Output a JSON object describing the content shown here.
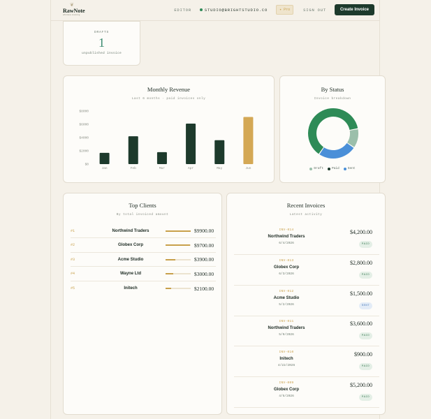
{
  "header": {
    "logo_name": "RawNote",
    "logo_tagline": "effortless invoicing",
    "nav_editor": "EDITOR",
    "email": "STUDIO@BRIGHTSTUDIO.CO",
    "pro_label": "✦ Pro",
    "sign_out": "SIGN OUT",
    "create_button": "Create Invoice"
  },
  "drafts": {
    "label": "DRAFTS",
    "count": "1",
    "sub": "unpublished invoice"
  },
  "revenue": {
    "title": "Monthly Revenue",
    "subtitle": "Last 6 months · paid invoices only"
  },
  "status": {
    "title": "By Status",
    "subtitle": "Invoice breakdown",
    "legend": [
      "Draft",
      "Paid",
      "Sent"
    ]
  },
  "chart_data": [
    {
      "type": "bar",
      "categories": [
        "Jan",
        "Feb",
        "Mar",
        "Apr",
        "May",
        "Jun"
      ],
      "values": [
        1700,
        4200,
        1800,
        6100,
        3600,
        7100
      ],
      "ylim": [
        0,
        8000
      ],
      "yticks": [
        "$0",
        "$2000",
        "$4000",
        "$6000",
        "$8000"
      ],
      "colors": [
        "#1d3a2c",
        "#1d3a2c",
        "#1d3a2c",
        "#1d3a2c",
        "#1d3a2c",
        "#d4a855"
      ],
      "title": "Monthly Revenue",
      "subtitle": "Last 6 months · paid invoices only"
    },
    {
      "type": "pie",
      "categories": [
        "Draft",
        "Paid",
        "Sent"
      ],
      "values": [
        1,
        5,
        2
      ],
      "colors": [
        "#9bbfab",
        "#2e8b57",
        "#4a8fd8"
      ],
      "title": "By Status",
      "subtitle": "Invoice breakdown"
    }
  ],
  "clients": {
    "title": "Top Clients",
    "subtitle": "By total invoiced amount",
    "rows": [
      {
        "rank": "#1",
        "name": "Northwind Traders",
        "amount": "$9900.00",
        "share": 1.0
      },
      {
        "rank": "#2",
        "name": "Globex Corp",
        "amount": "$9700.00",
        "share": 0.98
      },
      {
        "rank": "#3",
        "name": "Acme Studio",
        "amount": "$3900.00",
        "share": 0.39
      },
      {
        "rank": "#4",
        "name": "Wayne Ltd",
        "amount": "$3000.00",
        "share": 0.3
      },
      {
        "rank": "#5",
        "name": "Initech",
        "amount": "$2100.00",
        "share": 0.21
      }
    ]
  },
  "recent": {
    "title": "Recent Invoices",
    "subtitle": "Latest activity",
    "rows": [
      {
        "number": "INV-014",
        "client": "Northwind Traders",
        "date": "6/4/2026",
        "amount": "$4,200.00",
        "status": "PAID"
      },
      {
        "number": "INV-013",
        "client": "Globex Corp",
        "date": "6/3/2026",
        "amount": "$2,800.00",
        "status": "PAID"
      },
      {
        "number": "INV-012",
        "client": "Acme Studio",
        "date": "5/2/2026",
        "amount": "$1,500.00",
        "status": "SENT"
      },
      {
        "number": "INV-011",
        "client": "Northwind Traders",
        "date": "5/9/2026",
        "amount": "$3,600.00",
        "status": "PAID"
      },
      {
        "number": "INV-010",
        "client": "Initech",
        "date": "4/22/2026",
        "amount": "$900.00",
        "status": "PAID"
      },
      {
        "number": "INV-009",
        "client": "Globex Corp",
        "date": "4/5/2026",
        "amount": "$5,200.00",
        "status": "PAID"
      }
    ]
  }
}
